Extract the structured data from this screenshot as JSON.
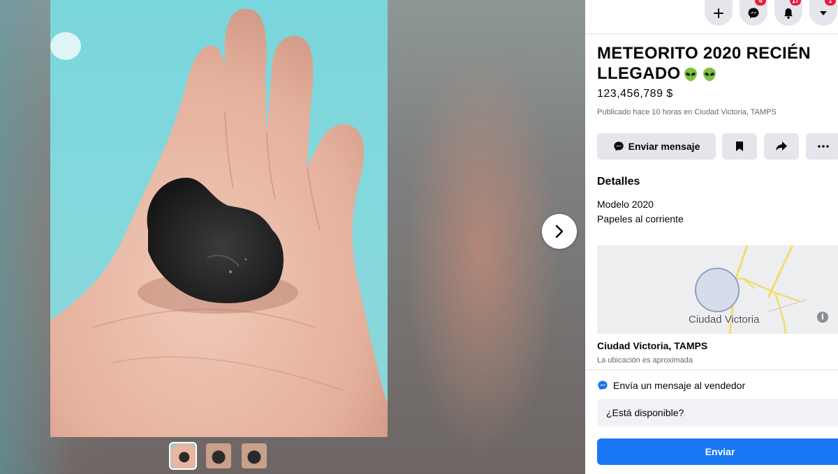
{
  "listing": {
    "title": "METEORITO 2020 RECIÉN LLEGADO",
    "title_emoji": [
      "alien-icon",
      "alien-icon"
    ],
    "price": "123,456,789 $",
    "posted": "Publicado hace 10 horas en Ciudad Victoria, TAMPS"
  },
  "actions": {
    "message_label": "Enviar mensaje",
    "icons": [
      "messenger-icon",
      "bookmark-icon",
      "share-icon",
      "more-icon"
    ]
  },
  "details": {
    "heading": "Detalles",
    "items": [
      "Modelo 2020",
      "Papeles al corriente"
    ]
  },
  "location": {
    "map_label": "Ciudad Victoria",
    "map_info": "i",
    "name": "Ciudad Victoria, TAMPS",
    "note": "La ubicación es aproximada"
  },
  "seller_message": {
    "heading": "Envía un mensaje al vendedor",
    "input_value": "¿Está disponible?",
    "send_label": "Enviar"
  },
  "top_nav": {
    "icons": [
      "plus-icon",
      "messenger-icon",
      "bell-icon",
      "caret-down-icon"
    ],
    "messenger_badge": "4",
    "notifications_badge": "17",
    "menu_badge": "1"
  },
  "viewer": {
    "thumbnails": 3,
    "selected_thumbnail": 1
  },
  "colors": {
    "primary": "#1877f2",
    "button_gray": "#e4e6eb",
    "badge_red": "#e41e3f",
    "alien_green": "#7cc242"
  }
}
